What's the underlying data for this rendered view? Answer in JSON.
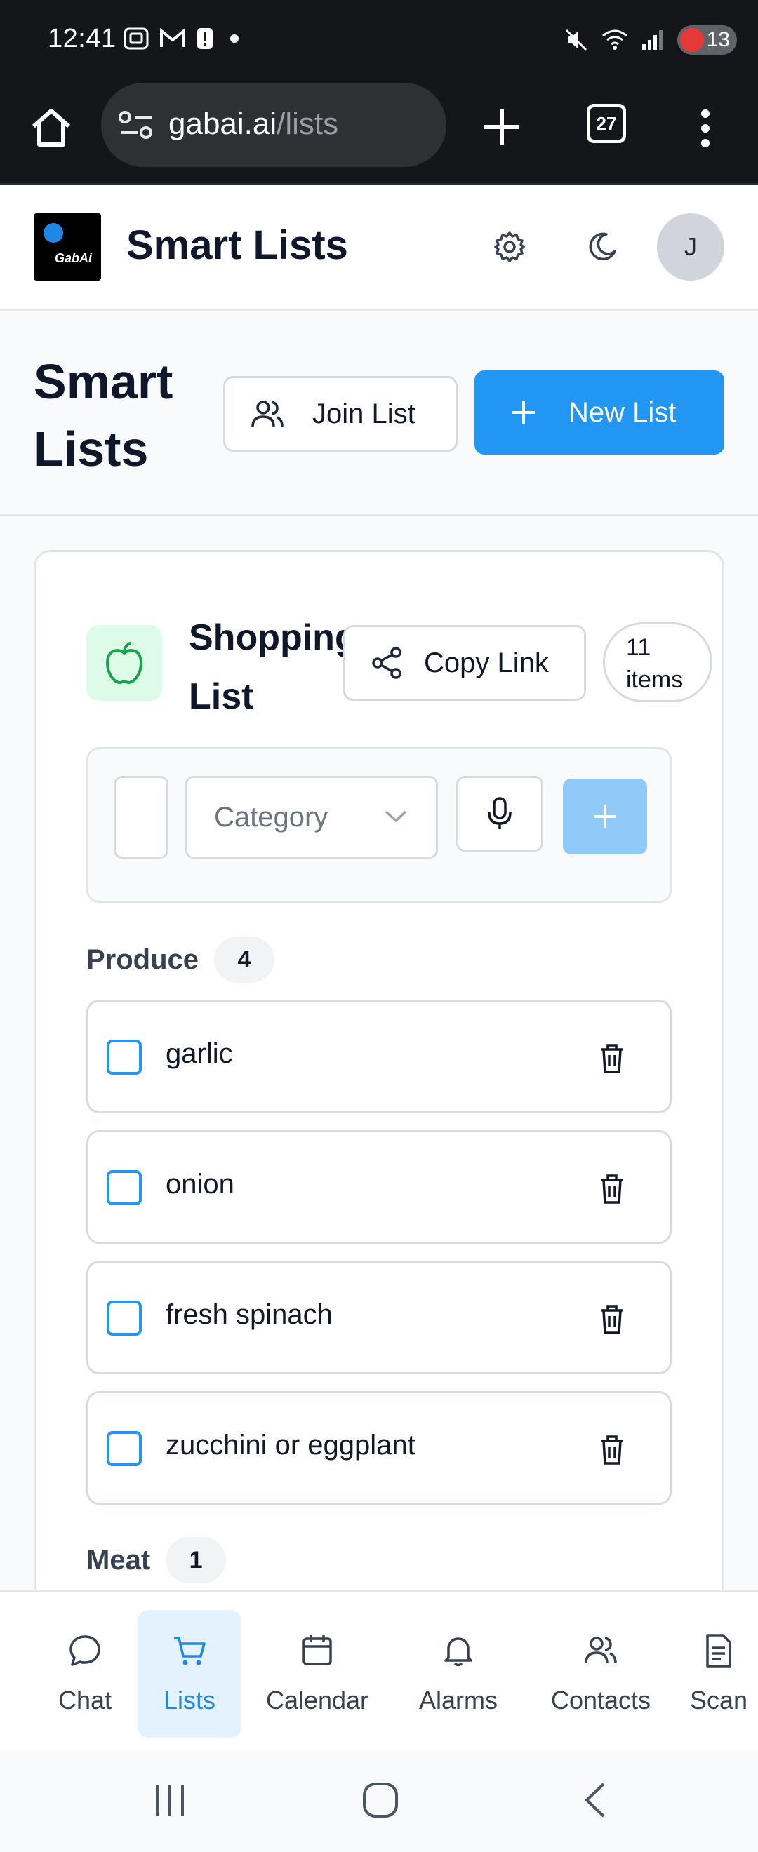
{
  "status_bar": {
    "time": "12:41",
    "battery": "13"
  },
  "browser": {
    "url_host": "gabai.ai",
    "url_path": "/lists",
    "tab_count": "27"
  },
  "app": {
    "logo_text": "GabAi",
    "title": "Smart Lists",
    "avatar_initial": "J"
  },
  "page": {
    "title": "Smart Lists",
    "join_label": "Join List",
    "new_label": "New List"
  },
  "list": {
    "name": "Shopping List",
    "copy_label": "Copy Link",
    "count_number": "11",
    "count_unit": "items",
    "category_placeholder": "Category",
    "sections": [
      {
        "name": "Produce",
        "count": "4",
        "items": [
          "garlic",
          "onion",
          "fresh spinach",
          "zucchini or eggplant"
        ]
      },
      {
        "name": "Meat",
        "count": "1",
        "items": []
      }
    ]
  },
  "nav": {
    "items": [
      {
        "label": "Chat",
        "icon": "chat-bubble-icon"
      },
      {
        "label": "Lists",
        "icon": "shopping-cart-icon",
        "active": true
      },
      {
        "label": "Calendar",
        "icon": "calendar-icon"
      },
      {
        "label": "Alarms",
        "icon": "bell-icon"
      },
      {
        "label": "Contacts",
        "icon": "users-icon"
      },
      {
        "label": "Scan",
        "icon": "document-icon"
      }
    ]
  },
  "colors": {
    "primary": "#2196f3",
    "primary_disabled": "#90caf9",
    "list_icon_bg": "#dcfce7",
    "list_icon": "#16a34a",
    "active_nav_bg": "#e3f2fd"
  }
}
